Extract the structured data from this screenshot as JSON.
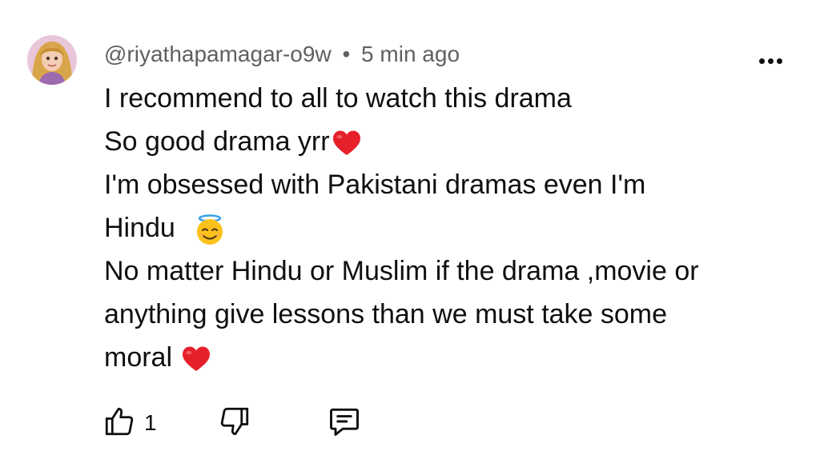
{
  "comment": {
    "author": "@riyathapamagar-o9w",
    "separator": "•",
    "timestamp": "5 min ago",
    "lines": [
      "I recommend to all to watch this drama",
      "So good drama yrr",
      "I'm obsessed with Pakistani dramas even I'm",
      "Hindu ",
      "No matter Hindu or Muslim if the drama ,movie or",
      "anything give lessons than we must take some",
      "moral "
    ],
    "likes": "1"
  },
  "icons": {
    "avatar": "avatar-image",
    "more": "more-options-icon",
    "like": "thumbs-up-icon",
    "dislike": "thumbs-down-icon",
    "reply": "comment-reply-icon",
    "heart": "red-heart-emoji",
    "halo": "smiling-face-with-halo-emoji"
  },
  "colors": {
    "text": "#0f0f0f",
    "meta": "#606060",
    "heart": "#e6202b",
    "emoji_face": "#fcc21b"
  }
}
